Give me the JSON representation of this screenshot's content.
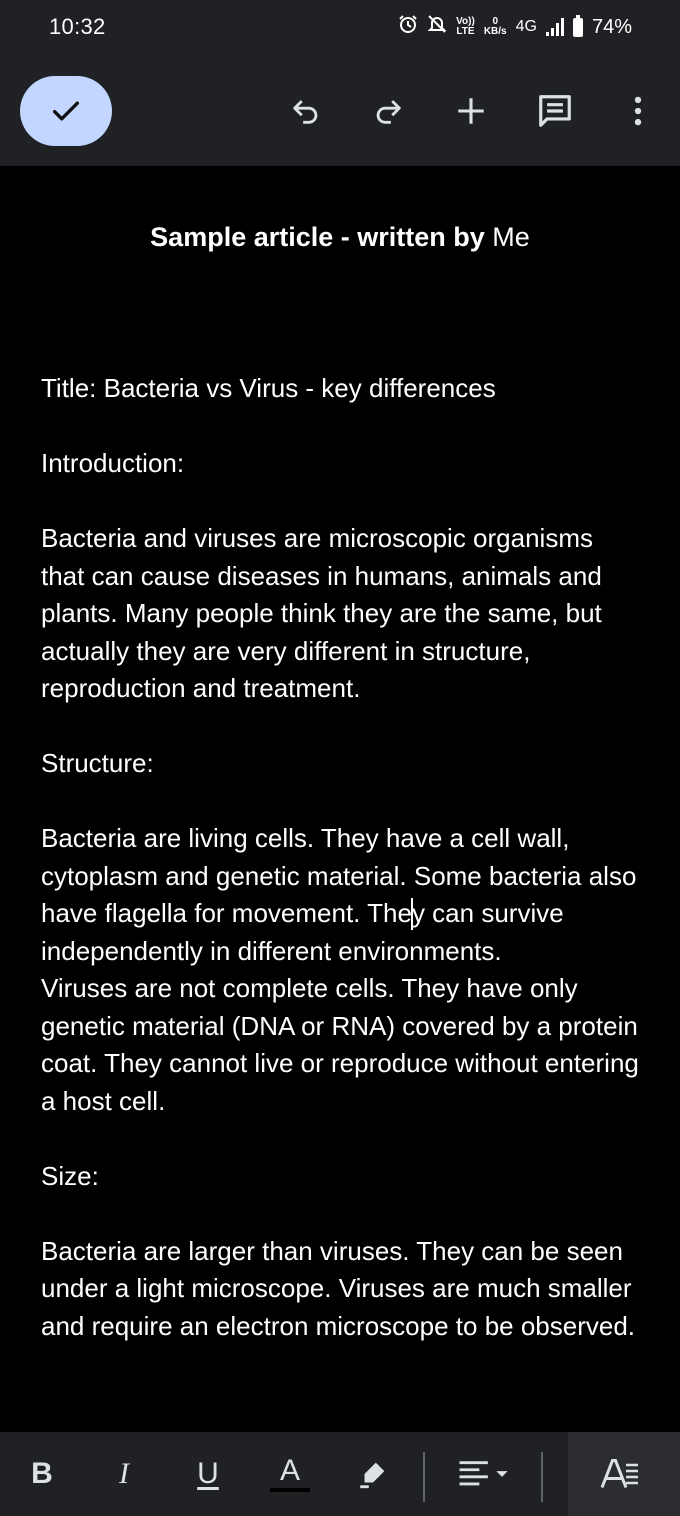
{
  "status_bar": {
    "time": "10:32",
    "battery": "74%",
    "network": "4G",
    "volte_top": "Vo))",
    "volte_bottom": "LTE",
    "speed_value": "0",
    "speed_unit": "KB/s",
    "icons": [
      "alarm-icon",
      "mute-icon",
      "volte-icon",
      "data-speed",
      "signal-icon",
      "battery-icon"
    ]
  },
  "toolbar": {
    "icons": [
      "check-icon",
      "undo-icon",
      "redo-icon",
      "add-icon",
      "comment-icon",
      "more-vert-icon"
    ],
    "accent_color": "#c3d6ff"
  },
  "document": {
    "title_bold": "Sample article - written by",
    "title_author": "Me",
    "paragraphs": {
      "p1": "Title: Bacteria vs Virus - key differences",
      "p2": "Introduction:",
      "p3": "Bacteria and viruses are microscopic organisms that can cause diseases in humans, animals and plants. Many people think they are the same, but actually they are very different in structure, reproduction and treatment.",
      "p4": "Structure:",
      "p5_before_cursor": "Bacteria are living cells. They have a cell wall, cytoplasm and genetic material. Some bacteria also have flagella for movement. The",
      "p5_after_cursor": "y can survive independently in different environments.",
      "p6": "Viruses are not complete cells. They have only genetic material (DNA or RNA) covered by a protein coat. They cannot live or reproduce without entering a host cell.",
      "p7": "Size:",
      "p8": "Bacteria are larger than viruses. They can be seen under a light microscope. Viruses are much smaller and require an electron microscope to be observed."
    }
  },
  "format_bar": {
    "bold_label": "B",
    "italic_label": "I",
    "underline_label": "U",
    "text_color_label": "A",
    "icons": [
      "bold-icon",
      "italic-icon",
      "underline-icon",
      "text-color-icon",
      "highlight-icon",
      "align-icon",
      "text-format-icon"
    ]
  }
}
